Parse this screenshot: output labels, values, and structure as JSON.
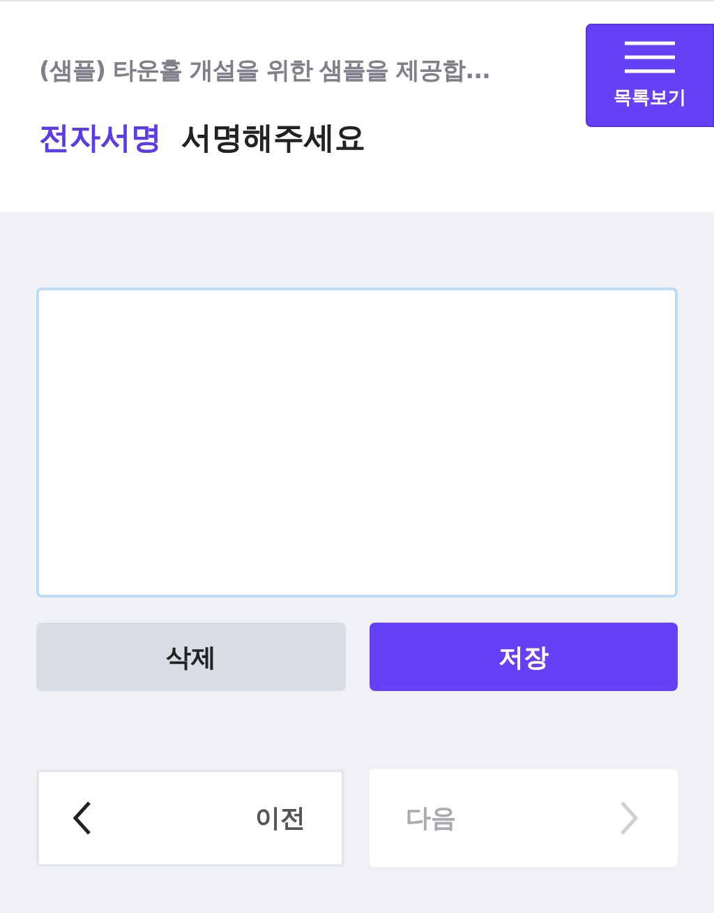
{
  "header": {
    "title": "(샘플) 타운홀 개설을 위한 샘플을 제공합...",
    "menu_button": {
      "label": "목록보기"
    },
    "section_label": "전자서명",
    "heading": "서명해주세요"
  },
  "signature_pad": {
    "focused": true
  },
  "actions": [
    {
      "label": "삭제",
      "kind": "secondary"
    },
    {
      "label": "저장",
      "kind": "primary"
    }
  ],
  "navigation": [
    {
      "label": "이전",
      "kind": "prev",
      "disabled": false
    },
    {
      "label": "다음",
      "kind": "next",
      "disabled": true
    }
  ]
}
